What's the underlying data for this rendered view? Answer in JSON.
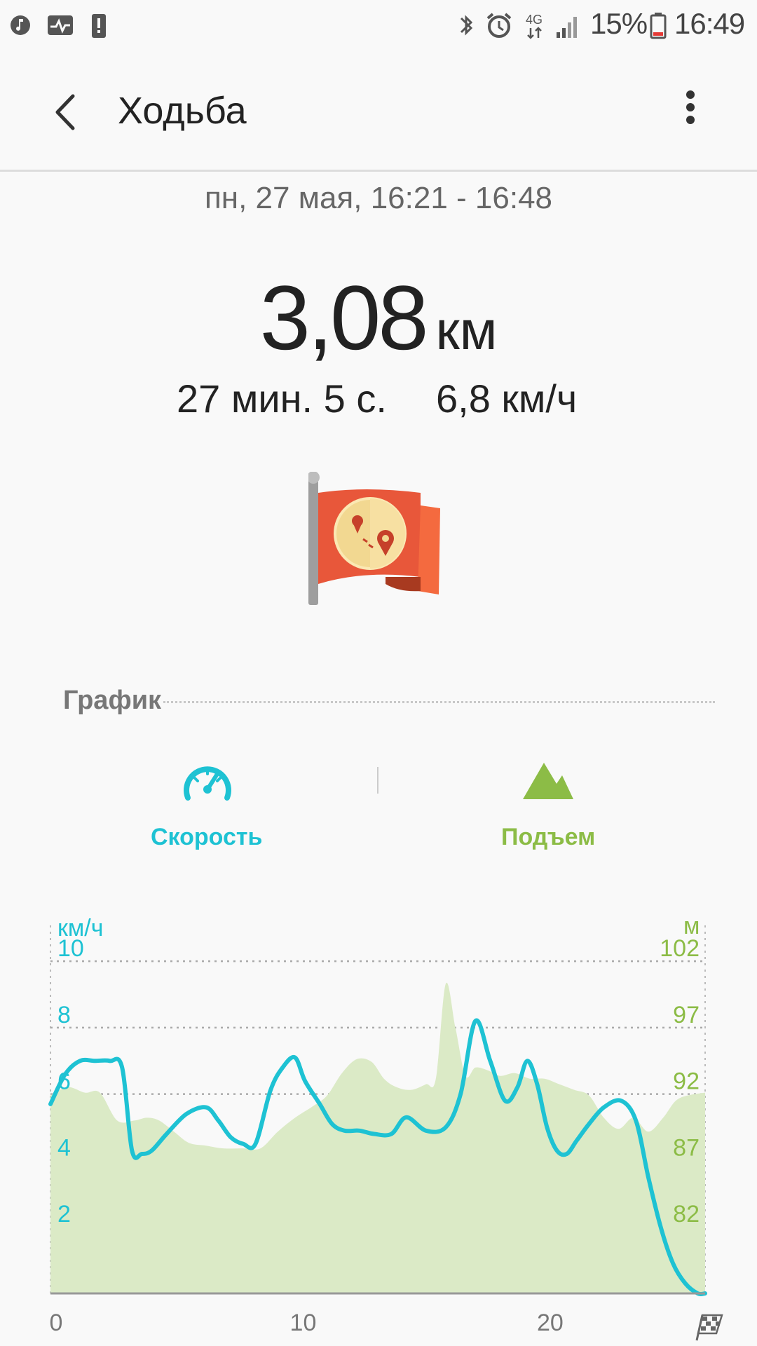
{
  "status_bar": {
    "battery_percent": "15%",
    "time": "16:49",
    "network": "4G",
    "icons": [
      "music-note-icon",
      "activity-icon",
      "alert-icon",
      "bluetooth-icon",
      "alarm-icon",
      "network-4g-icon",
      "signal-icon",
      "battery-icon"
    ]
  },
  "app_bar": {
    "title": "Ходьба",
    "back_icon": "back-arrow-icon",
    "more_icon": "more-vertical-icon"
  },
  "session": {
    "datetime": "пн, 27 мая, 16:21 - 16:48",
    "distance_value": "3,08",
    "distance_unit": "км",
    "duration": "27 мин. 5 с.",
    "avg_speed": "6,8 км/ч",
    "badge_icon": "route-flag-icon"
  },
  "graph_section": {
    "title": "График",
    "metrics": [
      {
        "label": "Скорость",
        "icon": "speedometer-icon",
        "color": "#1ec2d3"
      },
      {
        "label": "Подъем",
        "icon": "mountain-icon",
        "color": "#8cbc46"
      }
    ]
  },
  "chart_data": {
    "type": "line",
    "left_axis": {
      "unit": "км/ч",
      "ticks": [
        "2",
        "4",
        "6",
        "8",
        "10"
      ],
      "range": [
        0,
        11.5
      ]
    },
    "right_axis": {
      "unit": "м",
      "ticks": [
        "82",
        "87",
        "92",
        "97",
        "102"
      ],
      "range": [
        76.5,
        103.9
      ]
    },
    "x_axis": {
      "ticks": [
        "0",
        "10",
        "20"
      ],
      "range": [
        0,
        26.5
      ],
      "end_icon": "finish-flag-icon"
    },
    "grid": true,
    "colors": {
      "speed": "#1ec2d3",
      "elevation_fill": "#dbeac6",
      "elevation_text": "#8cbc46"
    },
    "series": [
      {
        "axis": "left",
        "x": [
          0,
          0.6,
          1.2,
          1.8,
          2.4,
          2.9,
          3.3,
          3.7,
          4.1,
          4.7,
          5.5,
          6.3,
          6.8,
          7.3,
          7.8,
          8.3,
          8.9,
          9.4,
          9.9,
          10.3,
          10.9,
          11.4,
          11.9,
          12.5,
          13.1,
          13.8,
          14.4,
          15.2,
          16.0,
          16.6,
          17.2,
          17.8,
          18.4,
          18.9,
          19.3,
          19.7,
          20.1,
          20.5,
          20.9,
          21.3,
          21.8,
          22.4,
          23.1,
          23.7,
          24.2,
          24.7,
          25.2,
          25.7,
          26.2,
          26.5
        ],
        "y": [
          5.7,
          6.6,
          7.0,
          7.0,
          7.0,
          6.8,
          4.3,
          4.2,
          4.3,
          4.8,
          5.4,
          5.6,
          5.2,
          4.7,
          4.5,
          4.5,
          6.1,
          6.8,
          7.1,
          6.4,
          5.7,
          5.1,
          4.9,
          4.9,
          4.8,
          4.8,
          5.3,
          4.9,
          5.0,
          6.0,
          8.2,
          7.0,
          5.8,
          6.2,
          7.0,
          6.3,
          5.0,
          4.3,
          4.2,
          4.6,
          5.1,
          5.6,
          5.8,
          5.2,
          3.5,
          2.0,
          0.9,
          0.3,
          0.0,
          0.0
        ]
      },
      {
        "axis": "right",
        "x": [
          0,
          0.7,
          1.4,
          2.0,
          2.7,
          3.4,
          3.9,
          4.4,
          5.0,
          5.6,
          6.3,
          7.0,
          7.8,
          8.5,
          9.2,
          9.9,
          10.6,
          11.2,
          11.8,
          12.4,
          13.0,
          13.5,
          14.0,
          14.6,
          15.2,
          15.6,
          16.0,
          16.4,
          16.8,
          17.2,
          17.7,
          18.2,
          18.8,
          19.4,
          20.0,
          20.6,
          21.2,
          21.8,
          22.4,
          23.0,
          23.6,
          24.2,
          24.8,
          25.3,
          25.8,
          26.5
        ],
        "y": [
          90.7,
          91.3,
          90.9,
          90.9,
          88.9,
          88.9,
          89.1,
          88.9,
          88.1,
          87.3,
          87.1,
          86.9,
          86.9,
          86.9,
          88.1,
          89.1,
          89.9,
          90.7,
          92.3,
          93.3,
          93.1,
          91.9,
          91.3,
          91.1,
          91.5,
          91.9,
          98.7,
          95.5,
          92.1,
          92.7,
          92.5,
          92.1,
          92.3,
          91.9,
          91.9,
          91.5,
          91.1,
          90.7,
          89.1,
          88.3,
          89.1,
          88.1,
          89.1,
          90.3,
          90.7,
          90.9
        ]
      }
    ]
  }
}
